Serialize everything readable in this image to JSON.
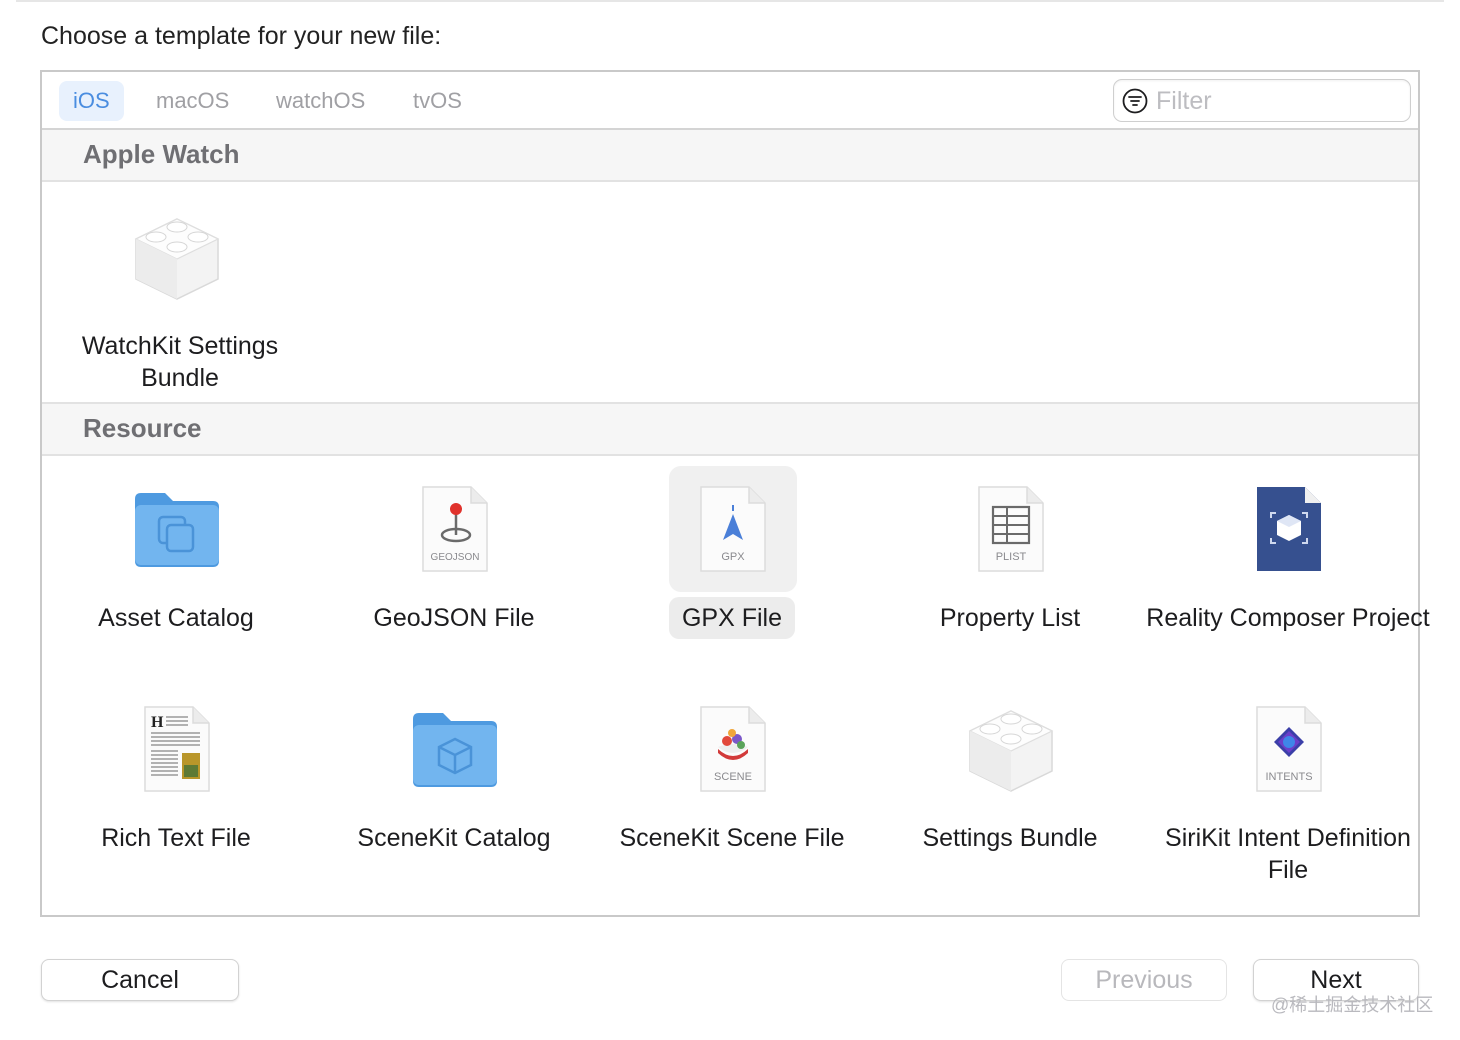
{
  "prompt": "Choose a template for your new file:",
  "platform_tabs": [
    {
      "label": "iOS",
      "active": true
    },
    {
      "label": "macOS",
      "active": false
    },
    {
      "label": "watchOS",
      "active": false
    },
    {
      "label": "tvOS",
      "active": false
    }
  ],
  "filter": {
    "placeholder": "Filter",
    "value": "",
    "icon": "filter-circle-icon"
  },
  "sections": [
    {
      "title": "Apple Watch",
      "items": [
        {
          "label": "WatchKit Settings Bundle",
          "icon": "settings-bundle-brick-icon"
        }
      ]
    },
    {
      "title": "Resource",
      "items": [
        {
          "label": "Asset Catalog",
          "icon": "asset-catalog-folder-icon"
        },
        {
          "label": "GeoJSON File",
          "icon": "geojson-file-icon",
          "badge": "GEOJSON"
        },
        {
          "label": "GPX File",
          "icon": "gpx-file-icon",
          "badge": "GPX",
          "selected": true
        },
        {
          "label": "Property List",
          "icon": "plist-file-icon",
          "badge": "PLIST"
        },
        {
          "label": "Reality Composer Project",
          "icon": "reality-composer-icon"
        },
        {
          "label": "Rich Text File",
          "icon": "rich-text-file-icon"
        },
        {
          "label": "SceneKit Catalog",
          "icon": "scenekit-catalog-folder-icon"
        },
        {
          "label": "SceneKit Scene File",
          "icon": "scene-file-icon",
          "badge": "SCENE"
        },
        {
          "label": "Settings Bundle",
          "icon": "settings-bundle-brick-icon"
        },
        {
          "label": "SiriKit Intent Definition File",
          "icon": "intents-file-icon",
          "badge": "INTENTS"
        }
      ]
    }
  ],
  "buttons": {
    "cancel": "Cancel",
    "previous": "Previous",
    "next": "Next"
  },
  "previous_enabled": false,
  "watermark": "@稀土掘金技术社区",
  "colors": {
    "accent": "#4a8de0",
    "tab_active_bg": "#e8f1fd",
    "selection_bg": "#ececec"
  }
}
